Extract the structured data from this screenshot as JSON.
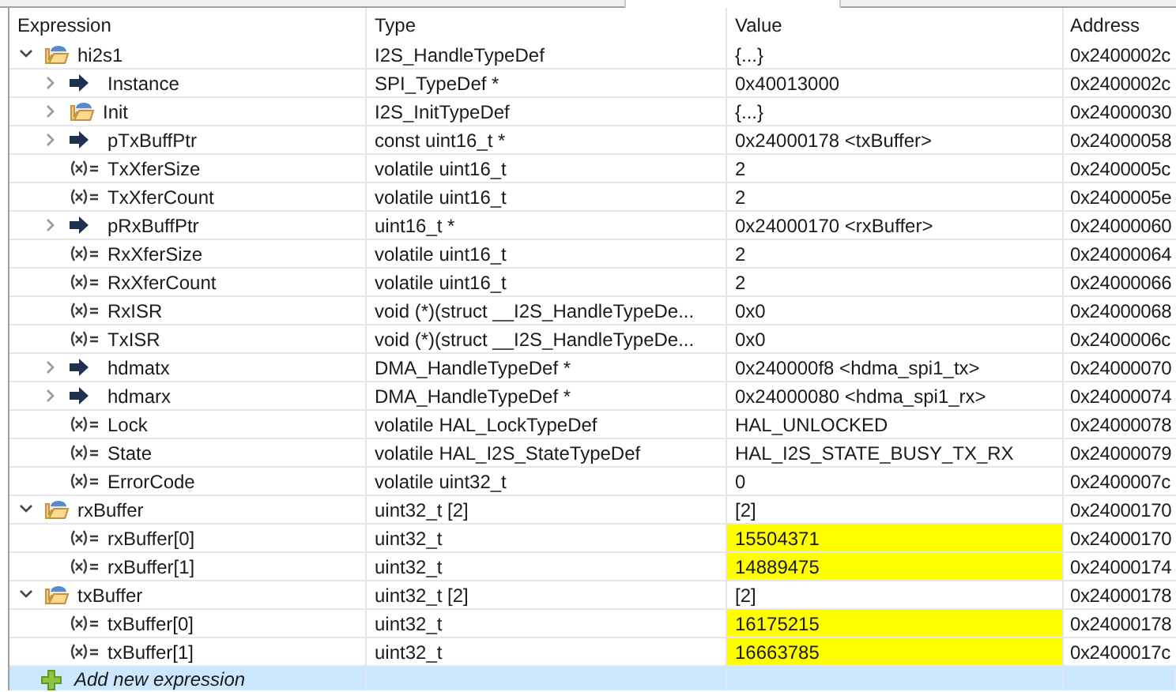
{
  "columns": [
    "Expression",
    "Type",
    "Value",
    "Address"
  ],
  "rows": [
    {
      "name": "hi2s1",
      "kind": "struct",
      "expanded": true,
      "type": "I2S_HandleTypeDef",
      "value": "{...}",
      "address": "0x2400002c",
      "changed": false,
      "children": [
        {
          "name": "Instance",
          "kind": "pointer",
          "expanded": false,
          "type": "SPI_TypeDef *",
          "value": "0x40013000",
          "address": "0x2400002c",
          "changed": false
        },
        {
          "name": "Init",
          "kind": "struct",
          "expanded": false,
          "type": "I2S_InitTypeDef",
          "value": "{...}",
          "address": "0x24000030",
          "changed": false
        },
        {
          "name": "pTxBuffPtr",
          "kind": "pointer",
          "expanded": false,
          "type": "const uint16_t *",
          "value": "0x24000178 <txBuffer>",
          "address": "0x24000058",
          "changed": false
        },
        {
          "name": "TxXferSize",
          "kind": "variable",
          "type": "volatile uint16_t",
          "value": "2",
          "address": "0x2400005c",
          "changed": false
        },
        {
          "name": "TxXferCount",
          "kind": "variable",
          "type": "volatile uint16_t",
          "value": "2",
          "address": "0x2400005e",
          "changed": false
        },
        {
          "name": "pRxBuffPtr",
          "kind": "pointer",
          "expanded": false,
          "type": "uint16_t *",
          "value": "0x24000170 <rxBuffer>",
          "address": "0x24000060",
          "changed": false
        },
        {
          "name": "RxXferSize",
          "kind": "variable",
          "type": "volatile uint16_t",
          "value": "2",
          "address": "0x24000064",
          "changed": false
        },
        {
          "name": "RxXferCount",
          "kind": "variable",
          "type": "volatile uint16_t",
          "value": "2",
          "address": "0x24000066",
          "changed": false
        },
        {
          "name": "RxISR",
          "kind": "variable",
          "type": "void (*)(struct __I2S_HandleTypeDe...",
          "value": "0x0",
          "address": "0x24000068",
          "changed": false
        },
        {
          "name": "TxISR",
          "kind": "variable",
          "type": "void (*)(struct __I2S_HandleTypeDe...",
          "value": "0x0",
          "address": "0x2400006c",
          "changed": false
        },
        {
          "name": "hdmatx",
          "kind": "pointer",
          "expanded": false,
          "type": "DMA_HandleTypeDef *",
          "value": "0x240000f8 <hdma_spi1_tx>",
          "address": "0x24000070",
          "changed": false
        },
        {
          "name": "hdmarx",
          "kind": "pointer",
          "expanded": false,
          "type": "DMA_HandleTypeDef *",
          "value": "0x24000080 <hdma_spi1_rx>",
          "address": "0x24000074",
          "changed": false
        },
        {
          "name": "Lock",
          "kind": "variable",
          "type": "volatile HAL_LockTypeDef",
          "value": "HAL_UNLOCKED",
          "address": "0x24000078",
          "changed": false
        },
        {
          "name": "State",
          "kind": "variable",
          "type": "volatile HAL_I2S_StateTypeDef",
          "value": "HAL_I2S_STATE_BUSY_TX_RX",
          "address": "0x24000079",
          "changed": false
        },
        {
          "name": "ErrorCode",
          "kind": "variable",
          "type": "volatile uint32_t",
          "value": "0",
          "address": "0x2400007c",
          "changed": false
        }
      ]
    },
    {
      "name": "rxBuffer",
      "kind": "struct",
      "expanded": true,
      "type": "uint32_t [2]",
      "value": "[2]",
      "address": "0x24000170",
      "changed": false,
      "children": [
        {
          "name": "rxBuffer[0]",
          "kind": "variable",
          "type": "uint32_t",
          "value": "15504371",
          "address": "0x24000170",
          "changed": true
        },
        {
          "name": "rxBuffer[1]",
          "kind": "variable",
          "type": "uint32_t",
          "value": "14889475",
          "address": "0x24000174",
          "changed": true
        }
      ]
    },
    {
      "name": "txBuffer",
      "kind": "struct",
      "expanded": true,
      "type": "uint32_t [2]",
      "value": "[2]",
      "address": "0x24000178",
      "changed": false,
      "children": [
        {
          "name": "txBuffer[0]",
          "kind": "variable",
          "type": "uint32_t",
          "value": "16175215",
          "address": "0x24000178",
          "changed": true
        },
        {
          "name": "txBuffer[1]",
          "kind": "variable",
          "type": "uint32_t",
          "value": "16663785",
          "address": "0x2400017c",
          "changed": true
        }
      ]
    }
  ],
  "add_row": {
    "label": "Add new expression",
    "selected": true
  }
}
